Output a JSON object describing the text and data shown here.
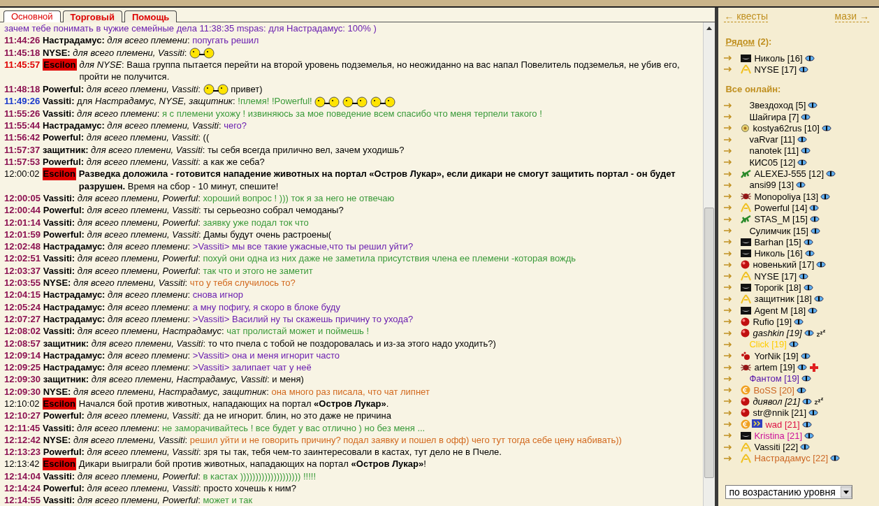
{
  "tabs": [
    {
      "label": "Основной",
      "selected": true
    },
    {
      "label": "Торговый",
      "selected": false
    },
    {
      "label": "Помощь",
      "selected": false
    }
  ],
  "messages": [
    {
      "kind": "continuation",
      "text": "зачем тебе понимать в чужие семейные дела 11:38:35 mspas: для Настрадамус: 100% )",
      "color": "#6a1fb0"
    },
    {
      "kind": "tribe",
      "time": "11:44:26",
      "sender": "Настрадамус:",
      "to": "*для всего племени*:",
      "text": "попугать решил",
      "color": "#6a1fb0"
    },
    {
      "kind": "tribe",
      "time": "11:45:18",
      "sender": "NYSE:",
      "to": "*для всего племени, Vassiti*:",
      "emoticons": [
        {
          "kind": "smiley"
        }
      ]
    },
    {
      "kind": "alert",
      "time": "11:45:57",
      "sender": "Escilon",
      "text": "*для NYSE*: Ваша группа пытается перейти на второй уровень подземелья, но неожиданно на вас напал Повелитель подземелья, не убив его, пройти не получится."
    },
    {
      "kind": "tribe",
      "time": "11:48:18",
      "sender": "Powerful:",
      "to": "*для всего племени, Vassiti*:",
      "text": "привет)",
      "color": "#000000",
      "emoticons": [
        {
          "kind": "smiley"
        }
      ],
      "emoticons_first": true
    },
    {
      "kind": "private",
      "time": "11:49:26",
      "sender": "Vassiti:",
      "to": "для *Настрадамус, NYSE, защитник*:",
      "text": "!племя! !Powerful!",
      "color": "#3a9a3a",
      "emoticons": [
        {
          "kind": "smiley"
        },
        {
          "kind": "smiley"
        },
        {
          "kind": "smiley"
        }
      ]
    },
    {
      "kind": "tribe",
      "time": "11:55:26",
      "sender": "Vassiti:",
      "to": "*для всего племени*:",
      "text": "я с племени ухожу ! извиняюсь за мое поведение всем спасибо что меня терпели такого !",
      "color": "#3a9a3a"
    },
    {
      "kind": "tribe",
      "time": "11:55:44",
      "sender": "Настрадамус:",
      "to": "*для всего племени, Vassiti*:",
      "text": "чего?",
      "color": "#6a1fb0"
    },
    {
      "kind": "tribe",
      "time": "11:56:42",
      "sender": "Powerful:",
      "to": "*для всего племени, Vassiti*:",
      "text": "((",
      "color": "#000000"
    },
    {
      "kind": "tribe",
      "time": "11:57:37",
      "sender": "защитник:",
      "to": "*для всего племени, Vassiti*:",
      "text": "ты себя всегда прилично вел, зачем уходишь?",
      "color": "#000000"
    },
    {
      "kind": "tribe",
      "time": "11:57:53",
      "sender": "Powerful:",
      "to": "*для всего племени, Vassiti*:",
      "text": "а как же себа?",
      "color": "#000000"
    },
    {
      "kind": "system",
      "time": "12:00:02",
      "sender": "Escilon",
      "text": "**Разведка доложила - готовится нападение животных на портал «Остров Лукар», если дикари не смогут защитить портал - он будет разрушен.** Время на сбор - 10 минут, спешите!"
    },
    {
      "kind": "tribe",
      "time": "12:00:05",
      "sender": "Vassiti:",
      "to": "*для всего племени, Powerful*:",
      "text": "хороший вопрос ! ))) ток я за него не отвечаю",
      "color": "#3a9a3a"
    },
    {
      "kind": "tribe",
      "time": "12:00:44",
      "sender": "Powerful:",
      "to": "*для всего племени, Vassiti*:",
      "text": "ты серьеозно собрал чемоданы?",
      "color": "#000000"
    },
    {
      "kind": "tribe",
      "time": "12:01:14",
      "sender": "Vassiti:",
      "to": "*для всего племени, Powerful*:",
      "text": "заявку уже подал ток что",
      "color": "#3a9a3a"
    },
    {
      "kind": "tribe",
      "time": "12:01:59",
      "sender": "Powerful:",
      "to": "*для всего племени, Vassiti*:",
      "text": "Дамы будут очень растроены(",
      "color": "#000000"
    },
    {
      "kind": "tribe",
      "time": "12:02:48",
      "sender": "Настрадамус:",
      "to": "*для всего племени*:",
      "text": ">Vassiti> мы все такие ужасные,что ты решил уйти?",
      "color": "#6a1fb0"
    },
    {
      "kind": "tribe",
      "time": "12:02:51",
      "sender": "Vassiti:",
      "to": "*для всего племени, Powerful*:",
      "text": "похуй они одна из них даже не заметила присутствия члена ее племени -которая вождь",
      "color": "#3a9a3a"
    },
    {
      "kind": "tribe",
      "time": "12:03:37",
      "sender": "Vassiti:",
      "to": "*для всего племени, Powerful*:",
      "text": "так что и этого не заметит",
      "color": "#3a9a3a"
    },
    {
      "kind": "tribe",
      "time": "12:03:55",
      "sender": "NYSE:",
      "to": "*для всего племени, Vassiti*:",
      "text": "что у тебя случилось то?",
      "color": "#d2691e"
    },
    {
      "kind": "tribe",
      "time": "12:04:15",
      "sender": "Настрадамус:",
      "to": "*для всего племени*:",
      "text": "снова игнор",
      "color": "#6a1fb0"
    },
    {
      "kind": "tribe",
      "time": "12:05:24",
      "sender": "Настрадамус:",
      "to": "*для всего племени*:",
      "text": "а мну пофигу, я скоро в блоке буду",
      "color": "#6a1fb0"
    },
    {
      "kind": "tribe",
      "time": "12:07:27",
      "sender": "Настрадамус:",
      "to": "*для всего племени*:",
      "text": ">Vassiti> Василий ну ты скажешь причину то ухода?",
      "color": "#6a1fb0"
    },
    {
      "kind": "tribe",
      "time": "12:08:02",
      "sender": "Vassiti:",
      "to": "*для всего племени, Настрадамус*:",
      "text": "чат пролистай может и поймешь !",
      "color": "#3a9a3a"
    },
    {
      "kind": "tribe",
      "time": "12:08:57",
      "sender": "защитник:",
      "to": "*для всего племени, Vassiti*:",
      "text": "то что пчела с тобой не поздоровалась и из-за этого надо уходить?)",
      "color": "#000000"
    },
    {
      "kind": "tribe",
      "time": "12:09:14",
      "sender": "Настрадамус:",
      "to": "*для всего племени*:",
      "text": ">Vassiti> она и меня игнорит часто",
      "color": "#6a1fb0"
    },
    {
      "kind": "tribe",
      "time": "12:09:25",
      "sender": "Настрадамус:",
      "to": "*для всего племени*:",
      "text": ">Vassiti> залипает чат у неё",
      "color": "#6a1fb0"
    },
    {
      "kind": "tribe",
      "time": "12:09:30",
      "sender": "защитник:",
      "to": "*для всего племени, Настрадамус, Vassiti*:",
      "text": "и меня)",
      "color": "#000000"
    },
    {
      "kind": "tribe",
      "time": "12:09:30",
      "sender": "NYSE:",
      "to": "*для всего племени, Настрадамус, защитник*:",
      "text": "она много раз писала, что чат липнет",
      "color": "#d2691e"
    },
    {
      "kind": "system",
      "time": "12:10:02",
      "sender": "Escilon",
      "text": "Начался бой против животных, нападающих на портал **«Остров Лукар»**."
    },
    {
      "kind": "tribe",
      "time": "12:10:27",
      "sender": "Powerful:",
      "to": "*для всего племени, Vassiti*:",
      "text": "да не игнорит. блин, но это даже не причина",
      "color": "#000000"
    },
    {
      "kind": "tribe",
      "time": "12:11:45",
      "sender": "Vassiti:",
      "to": "*для всего племени*:",
      "text": "не заморачивайтесь ! все будет у вас отлично ) но без меня ...",
      "color": "#3a9a3a"
    },
    {
      "kind": "tribe",
      "time": "12:12:42",
      "sender": "NYSE:",
      "to": "*для всего племени, Vassiti*:",
      "text": "решил уйти и не говорить причину? подал заявку и пошел в офф) чего тут тогда себе цену набивать))",
      "color": "#d2691e"
    },
    {
      "kind": "tribe",
      "time": "12:13:23",
      "sender": "Powerful:",
      "to": "*для всего племени, Vassiti*:",
      "text": "зря ты так, тебя чем-то заинтересовали в кастах, тут дело не в Пчеле.",
      "color": "#000000"
    },
    {
      "kind": "system",
      "time": "12:13:42",
      "sender": "Escilon",
      "text": "Дикари выиграли бой против животных, нападающих на портал **«Остров Лукар»**!"
    },
    {
      "kind": "tribe",
      "time": "12:14:04",
      "sender": "Vassiti:",
      "to": "*для всего племени, Powerful*:",
      "text": "в кастах )))))))))))))))))))) !!!!!",
      "color": "#3a9a3a"
    },
    {
      "kind": "tribe",
      "time": "12:14:24",
      "sender": "Powerful:",
      "to": "*для всего племени, Vassiti*:",
      "text": "просто хочешь к ним?",
      "color": "#000000"
    },
    {
      "kind": "tribe",
      "time": "12:14:55",
      "sender": "Vassiti:",
      "to": "*для всего племени, Powerful*:",
      "text": "может и так",
      "color": "#3a9a3a"
    }
  ],
  "sidebar": {
    "prev_link": "← квесты",
    "next_link": "мази →",
    "nearby_link": "Рядом",
    "nearby_count": "(2):",
    "all_online_title": "Все онлайн:",
    "nearby": [
      {
        "label": "Николь [16]",
        "icons": [
          {
            "kind": "mask"
          }
        ],
        "color": "#000000",
        "away": false,
        "injured": false
      },
      {
        "label": "NYSE [17]",
        "icons": [
          {
            "kind": "ribbon"
          }
        ],
        "color": "#000000",
        "away": false,
        "injured": false
      }
    ],
    "online": [
      {
        "label": "Звездоход [5]",
        "color": "#000000",
        "away": false,
        "injured": false
      },
      {
        "label": "Шайгира [7]",
        "color": "#000000",
        "away": false,
        "injured": false
      },
      {
        "label": "kostya62rus [10]",
        "icons": [
          {
            "kind": "flower"
          }
        ],
        "color": "#000000",
        "away": false,
        "injured": false
      },
      {
        "label": "vaRvar [11]",
        "color": "#000000",
        "away": false,
        "injured": false
      },
      {
        "label": "nanotek [11]",
        "color": "#000000",
        "away": false,
        "injured": false
      },
      {
        "label": "КИС05 [12]",
        "color": "#000000",
        "away": false,
        "injured": false
      },
      {
        "label": "ALEXEJ-555 [12]",
        "icons": [
          {
            "kind": "lizard"
          }
        ],
        "color": "#000000",
        "away": false,
        "injured": false
      },
      {
        "label": "ansi99 [13]",
        "color": "#000000",
        "away": false,
        "injured": false
      },
      {
        "label": "Monopoliya [13]",
        "icons": [
          {
            "kind": "bug"
          }
        ],
        "color": "#000000",
        "away": false,
        "injured": false
      },
      {
        "label": "Powerful [14]",
        "icons": [
          {
            "kind": "ribbon"
          }
        ],
        "color": "#000000",
        "away": false,
        "injured": false
      },
      {
        "label": "STAS_M [15]",
        "icons": [
          {
            "kind": "lizard"
          }
        ],
        "color": "#000000",
        "away": false,
        "injured": false
      },
      {
        "label": "Сулимчик [15]",
        "color": "#000000",
        "away": false,
        "injured": false
      },
      {
        "label": "Barhan [15]",
        "icons": [
          {
            "kind": "mask"
          }
        ],
        "color": "#000000",
        "away": false,
        "injured": false
      },
      {
        "label": "Николь [16]",
        "icons": [
          {
            "kind": "mask"
          }
        ],
        "color": "#000000",
        "away": false,
        "injured": false
      },
      {
        "label": "новенький [17]",
        "icons": [
          {
            "kind": "ball"
          }
        ],
        "color": "#000000",
        "away": false,
        "injured": false
      },
      {
        "label": "NYSE [17]",
        "icons": [
          {
            "kind": "ribbon"
          }
        ],
        "color": "#000000",
        "away": false,
        "injured": false
      },
      {
        "label": "Toporik [18]",
        "icons": [
          {
            "kind": "mask"
          }
        ],
        "color": "#000000",
        "away": false,
        "injured": false
      },
      {
        "label": "защитник [18]",
        "icons": [
          {
            "kind": "ribbon"
          }
        ],
        "color": "#000000",
        "away": false,
        "injured": false
      },
      {
        "label": "Agent M [18]",
        "icons": [
          {
            "kind": "mask"
          }
        ],
        "color": "#000000",
        "away": false,
        "injured": false
      },
      {
        "label": "Rufio [19]",
        "icons": [
          {
            "kind": "ball"
          }
        ],
        "color": "#000000",
        "away": false,
        "injured": false
      },
      {
        "label": "gashkin [19]",
        "icons": [
          {
            "kind": "ball"
          }
        ],
        "color": "#000000",
        "away": true,
        "injured": false
      },
      {
        "label": "Click [19]",
        "color": "#ffcc00",
        "away": false,
        "injured": false
      },
      {
        "label": "YorNik [19]",
        "icons": [
          {
            "kind": "splash"
          }
        ],
        "color": "#000000",
        "away": false,
        "injured": false
      },
      {
        "label": "artem [19]",
        "icons": [
          {
            "kind": "bug"
          }
        ],
        "color": "#000000",
        "away": false,
        "injured": true
      },
      {
        "label": "Фантом [19]",
        "color": "#5511aa",
        "away": false,
        "injured": false
      },
      {
        "label": "BoSS [20]",
        "icons": [
          {
            "kind": "euro"
          }
        ],
        "color": "#cc6622",
        "away": false,
        "injured": false
      },
      {
        "label": "диявол [21]",
        "icons": [
          {
            "kind": "ball"
          }
        ],
        "color": "#000000",
        "away": true,
        "injured": false
      },
      {
        "label": "str@nnik [21]",
        "icons": [
          {
            "kind": "ball"
          }
        ],
        "color": "#000000",
        "away": false,
        "injured": false
      },
      {
        "label": "wad [21]",
        "icons": [
          {
            "kind": "euro"
          },
          {
            "kind": "flag"
          }
        ],
        "color": "#dd1144",
        "away": false,
        "injured": false
      },
      {
        "label": "Kristina [21]",
        "icons": [
          {
            "kind": "mask"
          }
        ],
        "color": "#cc1199",
        "away": false,
        "injured": false
      },
      {
        "label": "Vassiti [22]",
        "icons": [
          {
            "kind": "ribbon"
          }
        ],
        "color": "#000000",
        "away": false,
        "injured": false
      },
      {
        "label": "Настрадамус [22]",
        "icons": [
          {
            "kind": "ribbon"
          }
        ],
        "color": "#cc6622",
        "away": false,
        "injured": false
      }
    ],
    "sort_select": "по возрастанию уровня"
  }
}
